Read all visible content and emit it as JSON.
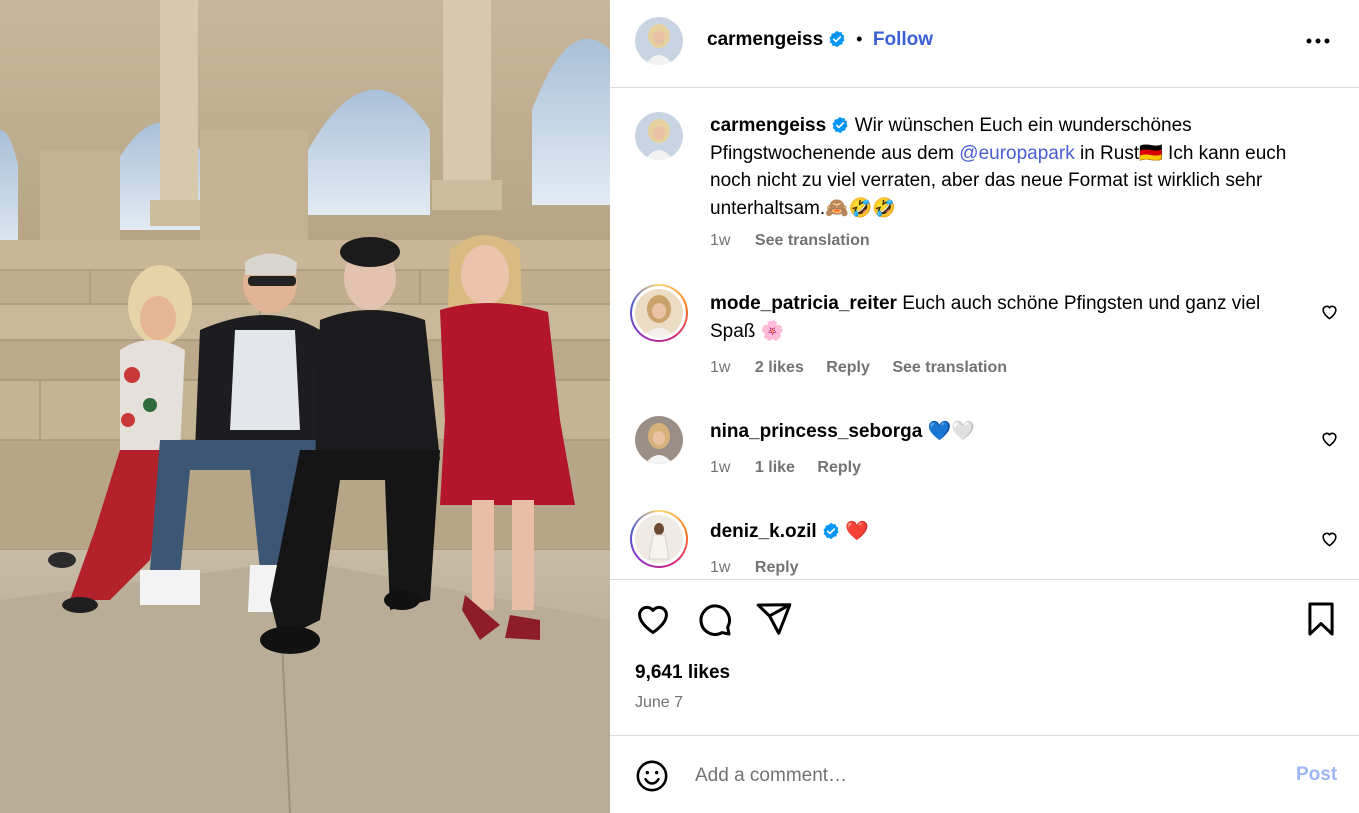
{
  "header": {
    "username": "carmengeiss",
    "separator": "•",
    "follow_label": "Follow",
    "more_icon": "more-options-icon"
  },
  "caption": {
    "username": "carmengeiss",
    "text_before_mention": "Wir wünschen Euch ein wunderschönes Pfingstwochenende aus dem ",
    "mention": "@europapark",
    "text_after_mention": " in Rust🇩🇪 Ich kann euch noch nicht zu viel verraten, aber das neue Format ist wirklich sehr unterhaltsam.🙈🤣🤣",
    "time": "1w",
    "see_translation": "See translation"
  },
  "comments": [
    {
      "username": "mode_patricia_reiter",
      "text": "Euch auch schöne Pfingsten und ganz viel Spaß 🌸",
      "time": "1w",
      "likes": "2 likes",
      "reply": "Reply",
      "see_translation": "See translation"
    },
    {
      "username": "nina_princess_seborga",
      "text": "💙🤍",
      "time": "1w",
      "likes": "1 like",
      "reply": "Reply"
    },
    {
      "username": "deniz_k.ozil",
      "text": "❤️",
      "time": "1w",
      "reply": "Reply"
    }
  ],
  "actions": {
    "like_icon": "heart-icon",
    "comment_icon": "comment-icon",
    "share_icon": "share-icon",
    "save_icon": "bookmark-icon"
  },
  "stats": {
    "likes": "9,641 likes",
    "date": "June 7"
  },
  "comment_box": {
    "emoji_icon": "emoji-icon",
    "placeholder": "Add a comment…",
    "post_label": "Post"
  },
  "colors": {
    "link_blue": "#3b5fd4",
    "mention_blue": "#4a5fd1",
    "muted_gray": "#737373",
    "post_disabled": "#9db6f5",
    "verified_blue": "#0095f6"
  }
}
